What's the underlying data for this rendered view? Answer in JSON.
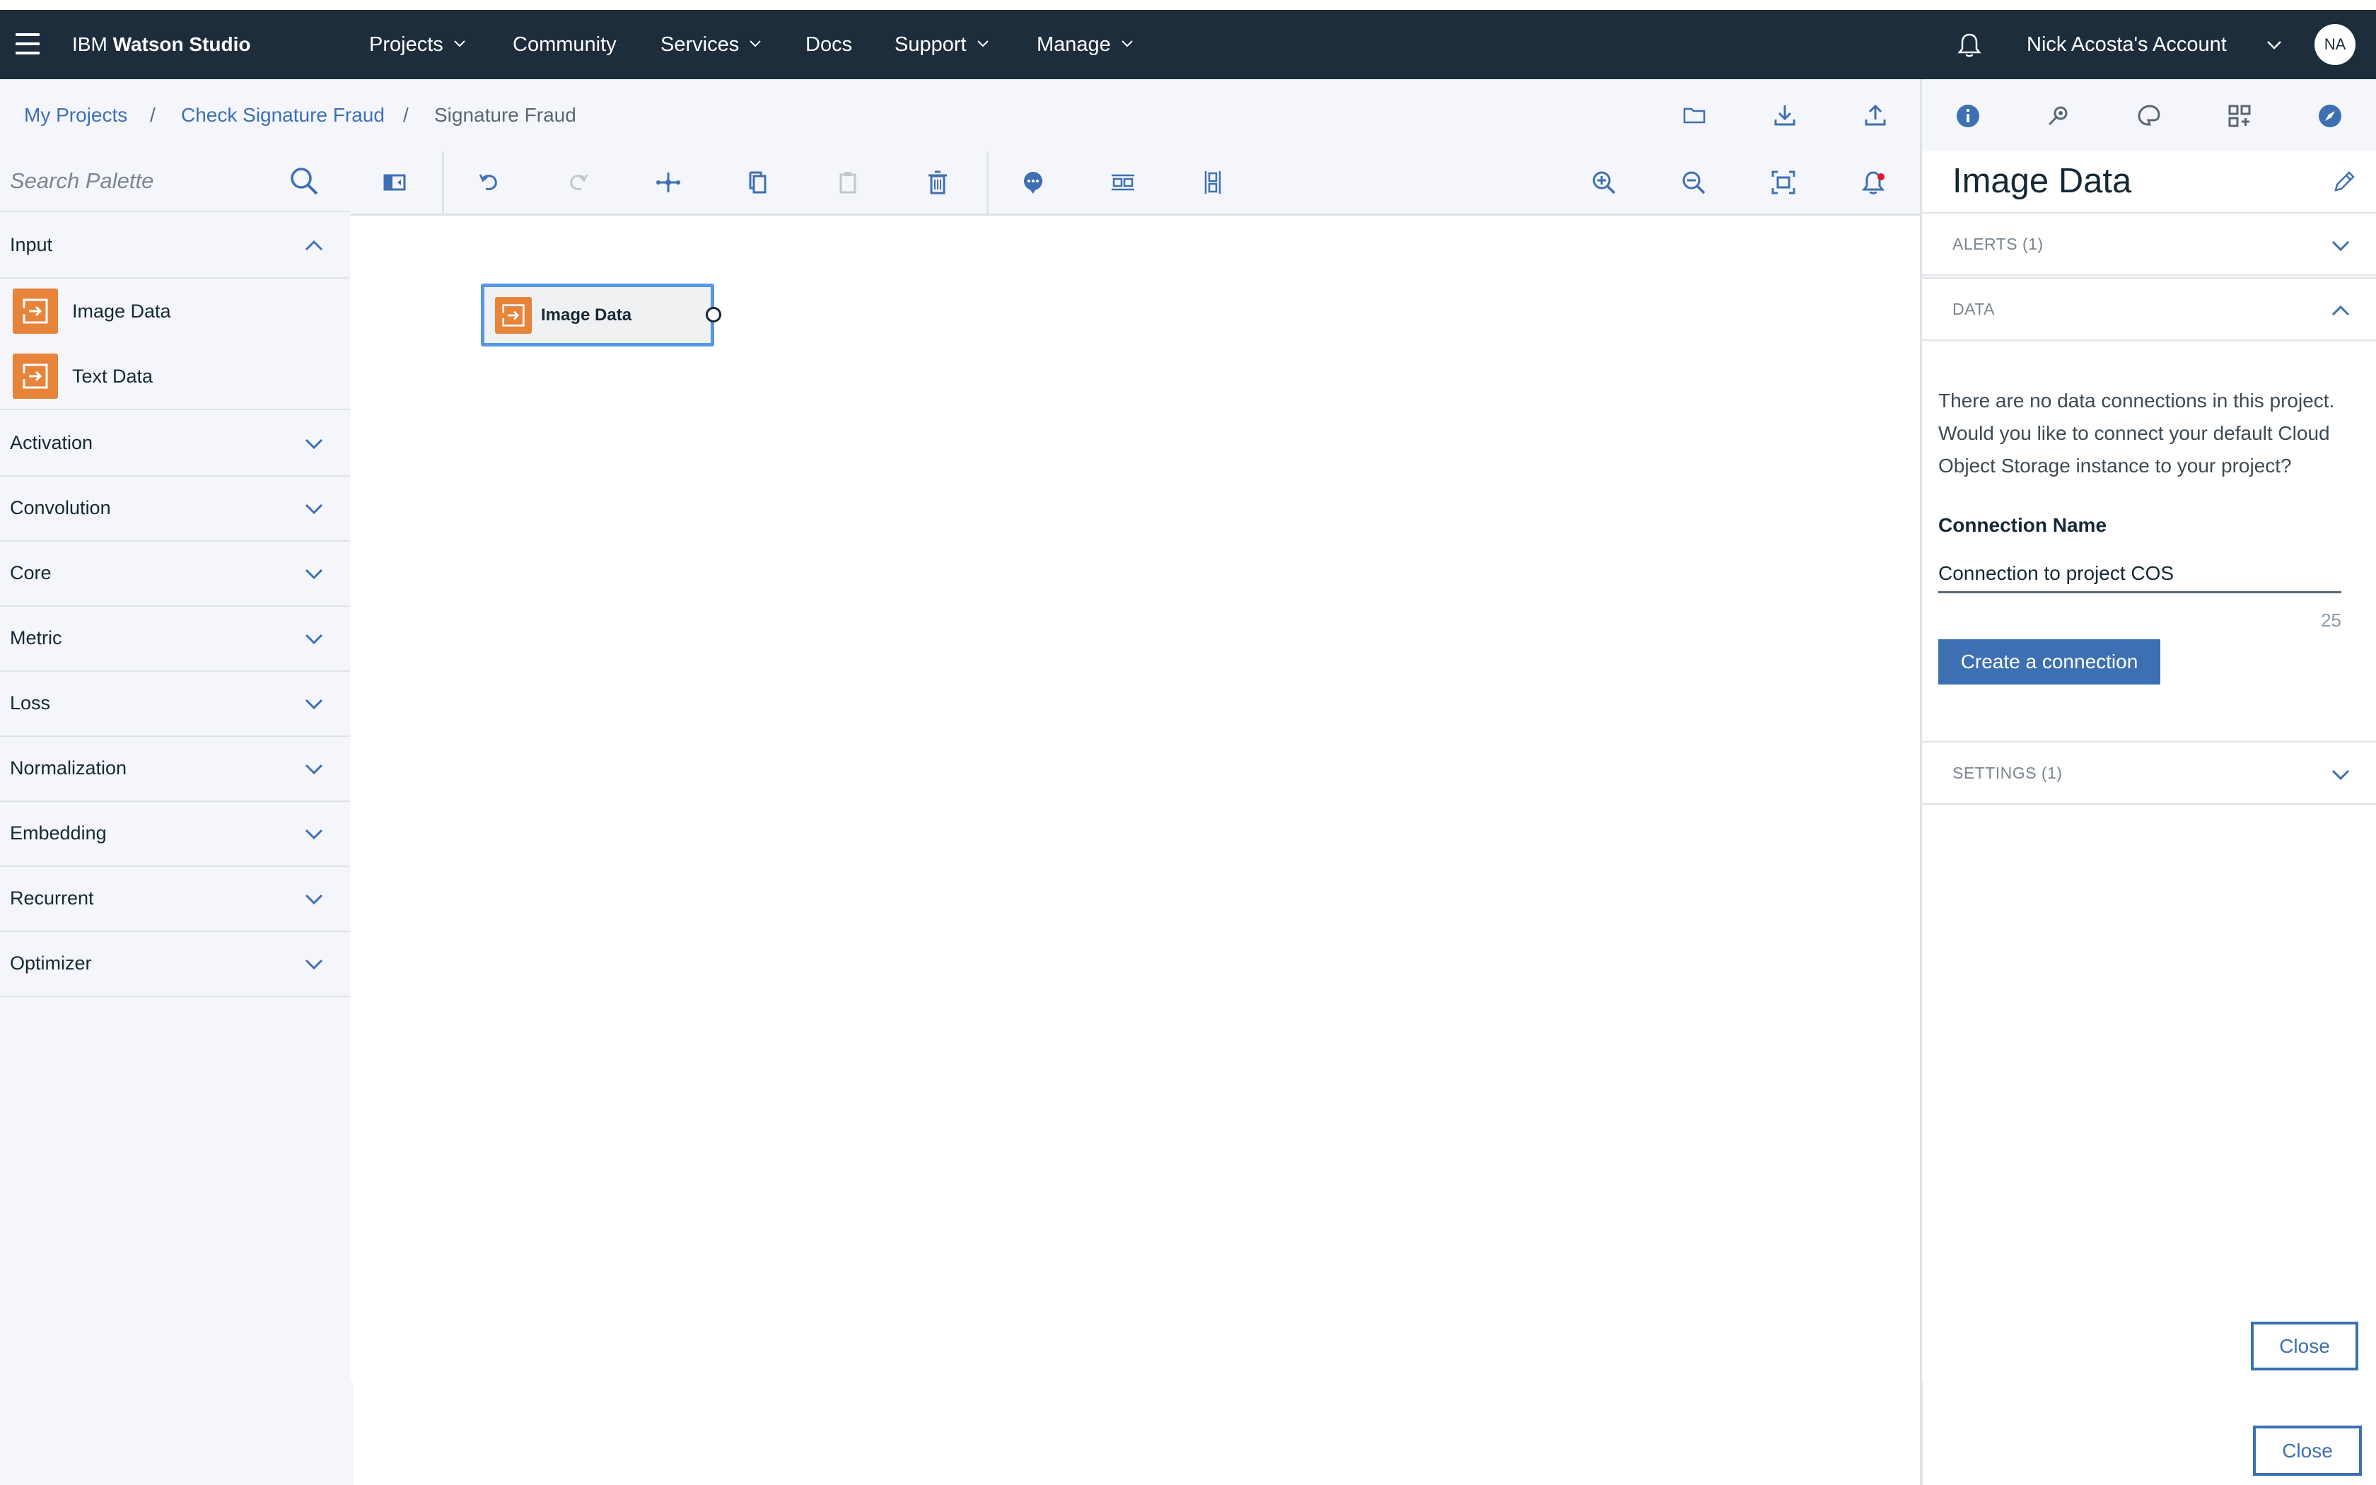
{
  "header": {
    "brand_prefix": "IBM",
    "brand_name": "Watson Studio",
    "nav": [
      {
        "label": "Projects",
        "has_menu": true
      },
      {
        "label": "Community",
        "has_menu": false
      },
      {
        "label": "Services",
        "has_menu": true
      },
      {
        "label": "Docs",
        "has_menu": false
      },
      {
        "label": "Support",
        "has_menu": true
      },
      {
        "label": "Manage",
        "has_menu": true
      }
    ],
    "account_name": "Nick Acosta's Account",
    "avatar_initials": "NA"
  },
  "breadcrumb": {
    "items": [
      "My Projects",
      "Check Signature Fraud",
      "Signature Fraud"
    ],
    "separator": "/"
  },
  "palette": {
    "search_placeholder": "Search Palette",
    "categories": [
      {
        "label": "Input",
        "expanded": true,
        "nodes": [
          "Image Data",
          "Text Data"
        ]
      },
      {
        "label": "Activation",
        "expanded": false
      },
      {
        "label": "Convolution",
        "expanded": false
      },
      {
        "label": "Core",
        "expanded": false
      },
      {
        "label": "Metric",
        "expanded": false
      },
      {
        "label": "Loss",
        "expanded": false
      },
      {
        "label": "Normalization",
        "expanded": false
      },
      {
        "label": "Embedding",
        "expanded": false
      },
      {
        "label": "Recurrent",
        "expanded": false
      },
      {
        "label": "Optimizer",
        "expanded": false
      }
    ]
  },
  "canvas": {
    "node_label": "Image Data"
  },
  "properties": {
    "title": "Image Data",
    "alerts_label": "ALERTS (1)",
    "data_label": "DATA",
    "settings_label": "SETTINGS (1)",
    "message": "There are no data connections in this project. Would you like to connect your default Cloud Object Storage instance to your project?",
    "connection_name_label": "Connection Name",
    "connection_name_value": "Connection to project COS",
    "char_count": "25",
    "create_button": "Create a connection",
    "close_button": "Close"
  },
  "colors": {
    "header_bg": "#1d2d3b",
    "accent_blue": "#3d70b2",
    "node_orange": "#e8833a",
    "selection_blue": "#5596e6",
    "panel_bg": "#f4f6fb"
  },
  "icons": {
    "breadcrumb_actions": [
      "folder-icon",
      "download-icon",
      "upload-icon"
    ],
    "right_panel_tabs": [
      "info-icon",
      "flow-icon",
      "palette-icon",
      "grid-icon",
      "compass-icon"
    ],
    "toolbar": [
      "toggle-palette-icon",
      "undo-icon",
      "redo-icon",
      "arrange-icon",
      "copy-icon",
      "paste-icon",
      "delete-icon",
      "comment-icon",
      "horizontal-layout-icon",
      "vertical-layout-icon",
      "zoom-in-icon",
      "zoom-out-icon",
      "fit-to-screen-icon",
      "notification-icon"
    ]
  }
}
